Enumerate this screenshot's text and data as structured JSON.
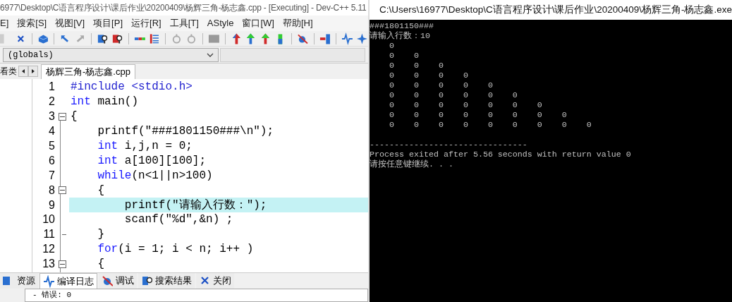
{
  "editor_window": {
    "title": "6977\\Desktop\\C语言程序设计\\课后作业\\20200409\\杨辉三角-杨志鑫.cpp - [Executing] - Dev-C++ 5.11",
    "menu": [
      "E]",
      "搜索[S]",
      "视图[V]",
      "项目[P]",
      "运行[R]",
      "工具[T]",
      "AStyle",
      "窗口[W]",
      "帮助[H]"
    ],
    "scope_dropdown": {
      "value": "(globals)"
    },
    "side_panel_tab": "看类",
    "file_tabs": [
      {
        "label": "杨辉三角-杨志鑫.cpp",
        "selected": true
      }
    ],
    "code_lines": [
      {
        "number": "1",
        "highlighted": false,
        "fold_start": false,
        "fold_end": false,
        "tokens": [
          {
            "kind": "preprocessor",
            "text": "#include <stdio.h>"
          }
        ]
      },
      {
        "number": "2",
        "highlighted": false,
        "fold_start": false,
        "fold_end": false,
        "tokens": [
          {
            "kind": "keyword",
            "text": "int"
          },
          {
            "kind": "plain",
            "text": " main()"
          }
        ]
      },
      {
        "number": "3",
        "highlighted": false,
        "fold_start": true,
        "fold_end": false,
        "tokens": [
          {
            "kind": "plain",
            "text": "{"
          }
        ]
      },
      {
        "number": "4",
        "highlighted": false,
        "fold_start": false,
        "fold_end": false,
        "tokens": [
          {
            "kind": "plain",
            "text": "    printf(\"###1801150###\\n\");"
          }
        ]
      },
      {
        "number": "5",
        "highlighted": false,
        "fold_start": false,
        "fold_end": false,
        "tokens": [
          {
            "kind": "keyword",
            "text": "    int"
          },
          {
            "kind": "plain",
            "text": " i,j,n = 0;"
          }
        ]
      },
      {
        "number": "6",
        "highlighted": false,
        "fold_start": false,
        "fold_end": false,
        "tokens": [
          {
            "kind": "keyword",
            "text": "    int"
          },
          {
            "kind": "plain",
            "text": " a[100][100];"
          }
        ]
      },
      {
        "number": "7",
        "highlighted": false,
        "fold_start": false,
        "fold_end": false,
        "tokens": [
          {
            "kind": "keyword",
            "text": "    while"
          },
          {
            "kind": "plain",
            "text": "(n<1||n>100)"
          }
        ]
      },
      {
        "number": "8",
        "highlighted": false,
        "fold_start": true,
        "fold_end": false,
        "tokens": [
          {
            "kind": "plain",
            "text": "    {"
          }
        ]
      },
      {
        "number": "9",
        "highlighted": true,
        "fold_start": false,
        "fold_end": false,
        "tokens": [
          {
            "kind": "plain",
            "text": "        printf(\"请输入行数：\");"
          }
        ]
      },
      {
        "number": "10",
        "highlighted": false,
        "fold_start": false,
        "fold_end": false,
        "tokens": [
          {
            "kind": "plain",
            "text": "        scanf(\"%d\",&n) ;"
          }
        ]
      },
      {
        "number": "11",
        "highlighted": false,
        "fold_start": false,
        "fold_end": true,
        "tokens": [
          {
            "kind": "plain",
            "text": "    }"
          }
        ]
      },
      {
        "number": "12",
        "highlighted": false,
        "fold_start": false,
        "fold_end": false,
        "tokens": [
          {
            "kind": "keyword",
            "text": "    for"
          },
          {
            "kind": "plain",
            "text": "(i = 1; i < n; i++ )"
          }
        ]
      },
      {
        "number": "13",
        "highlighted": false,
        "fold_start": true,
        "fold_end": false,
        "tokens": [
          {
            "kind": "plain",
            "text": "    {"
          }
        ]
      }
    ],
    "bottom_tabs": [
      {
        "label": "资源",
        "selected": false
      },
      {
        "label": "编译日志",
        "selected": true
      },
      {
        "label": "调试",
        "selected": false
      },
      {
        "label": "搜索结果",
        "selected": false
      },
      {
        "label": "关闭",
        "selected": false
      }
    ],
    "compile_log": [
      "- 错误: 0"
    ]
  },
  "console_window": {
    "title": "C:\\Users\\16977\\Desktop\\C语言程序设计\\课后作业\\20200409\\杨辉三角-杨志鑫.exe",
    "lines": [
      {
        "kind": "text",
        "text": "###1801150###"
      },
      {
        "kind": "text",
        "text": "请输入行数：10"
      },
      {
        "kind": "text",
        "text": "    0"
      },
      {
        "kind": "text",
        "text": "    0    0"
      },
      {
        "kind": "text",
        "text": "    0    0    0"
      },
      {
        "kind": "text",
        "text": "    0    0    0    0"
      },
      {
        "kind": "text",
        "text": "    0    0    0    0    0"
      },
      {
        "kind": "text",
        "text": "    0    0    0    0    0    0"
      },
      {
        "kind": "text",
        "text": "    0    0    0    0    0    0    0"
      },
      {
        "kind": "text",
        "text": "    0    0    0    0    0    0    0    0"
      },
      {
        "kind": "text",
        "text": "    0    0    0    0    0    0    0    0    0"
      },
      {
        "kind": "rule",
        "text": "--------------------------------"
      },
      {
        "kind": "text",
        "text": "Process exited after 5.56 seconds with return value 0"
      },
      {
        "kind": "text",
        "text": "请按任意键继续. . ."
      }
    ]
  }
}
